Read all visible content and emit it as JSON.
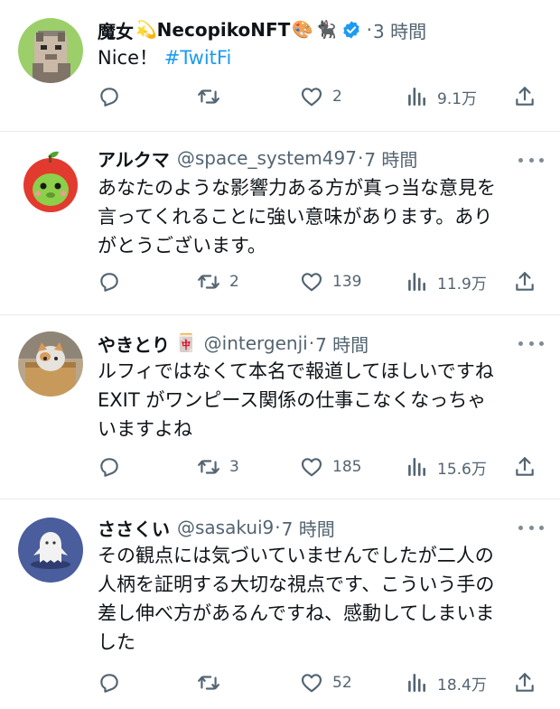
{
  "tweets": [
    {
      "name": "魔女",
      "name_suffix": "NecopikoNFT",
      "handle": "",
      "separator": "·",
      "time": "3 時間",
      "text_lines": [
        "Nice！"
      ],
      "hashtag": "#TwitFi",
      "replies": "",
      "retweets": "",
      "likes": "2",
      "views": "9.1万",
      "verified": true
    },
    {
      "name": "アルクマ",
      "handle": "@space_system497",
      "separator": "·",
      "time": "7 時間",
      "text_lines": [
        "あなたのような影響力ある方が真っ当な意見を",
        "言ってくれることに強い意味があります。あり",
        "がとうございます。"
      ],
      "replies": "",
      "retweets": "2",
      "likes": "139",
      "views": "11.9万"
    },
    {
      "name": "やきとり",
      "name_emoji": "🀄",
      "handle": "@intergenji",
      "separator": "·",
      "time": "7 時間",
      "text_lines": [
        "ルフィではなくて本名で報道してほしいですね",
        "EXIT がワンピース関係の仕事こなくなっちゃ",
        "いますよね"
      ],
      "replies": "",
      "retweets": "3",
      "likes": "185",
      "views": "15.6万"
    },
    {
      "name": "ささくい",
      "handle": "@sasakui9",
      "separator": "·",
      "time": "7 時間",
      "text_lines": [
        "その観点には気づいていませんでしたが二人の",
        "人柄を証明する大切な視点です、こういう手の",
        "差し伸べ方があるんですね、感動してしまいま",
        "した"
      ],
      "replies": "",
      "retweets": "",
      "likes": "52",
      "views": "18.4万"
    }
  ],
  "icons": {
    "reply": "reply-icon",
    "retweet": "retweet-icon",
    "like": "like-icon",
    "views": "views-icon",
    "share": "share-icon",
    "more": "more-icon",
    "verified": "verified-badge-icon"
  },
  "colors": {
    "text": "#0f1419",
    "secondary": "#536471",
    "link": "#1d9bf0",
    "divider": "#e7e9ea",
    "verified": "#1d9bf0"
  }
}
